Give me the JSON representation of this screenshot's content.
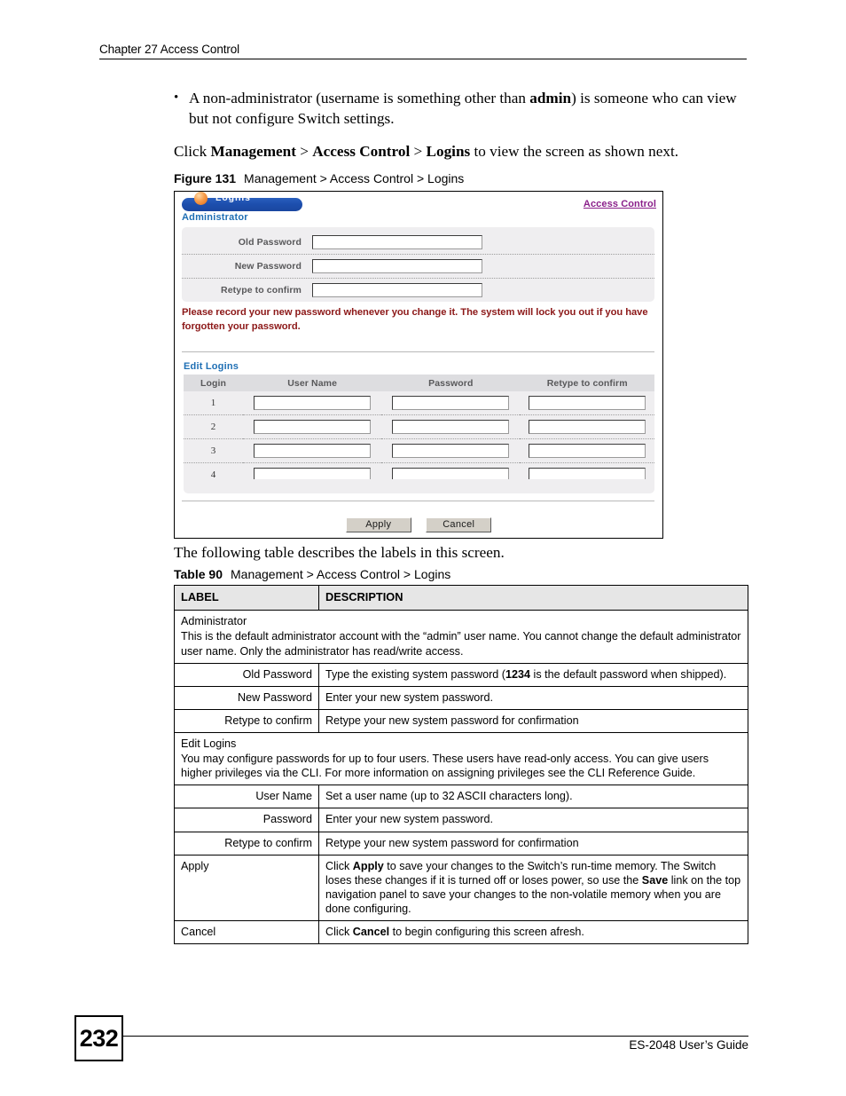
{
  "header": {
    "chapter": "Chapter 27 Access Control"
  },
  "body": {
    "bullet": {
      "marker": "•",
      "part1": " A non-administrator (username is something other than ",
      "bold1": "admin",
      "part2": ") is someone who can view but not configure Switch settings."
    },
    "click_line": {
      "part1": "Click ",
      "bold1": "Management",
      "part2": " > ",
      "bold2": "Access Control",
      "part3": " > ",
      "bold3": "Logins",
      "part4": " to view the screen as shown next."
    },
    "after_figure": "The following table describes the labels in this screen."
  },
  "figure": {
    "caption_number": "Figure 131",
    "caption_text": "Management > Access Control > Logins",
    "title": "Logins",
    "access_control_link": "Access Control",
    "administrator_heading": "Administrator",
    "edit_logins_heading": "Edit Logins",
    "admin_fields": [
      {
        "label": "Old Password",
        "value": ""
      },
      {
        "label": "New Password",
        "value": ""
      },
      {
        "label": "Retype to confirm",
        "value": ""
      }
    ],
    "warning": "Please record your new password whenever you change it. The system will lock you out if you have forgotten your password.",
    "logins_columns": [
      "Login",
      "User Name",
      "Password",
      "Retype to confirm"
    ],
    "logins_rows": [
      {
        "login": "1",
        "user_name": "",
        "password": "",
        "retype": ""
      },
      {
        "login": "2",
        "user_name": "",
        "password": "",
        "retype": ""
      },
      {
        "login": "3",
        "user_name": "",
        "password": "",
        "retype": ""
      },
      {
        "login": "4",
        "user_name": "",
        "password": "",
        "retype": ""
      }
    ],
    "buttons": {
      "apply": "Apply",
      "cancel": "Cancel"
    },
    "colors": {
      "title_bar": "#1d4fae",
      "ball": "#f0842f",
      "link": "#8a1f8a",
      "section_heading": "#1f6fb4",
      "warning": "#8c1818",
      "panel_bg": "#efeef0",
      "table_header_bg": "#dddde0"
    }
  },
  "table": {
    "caption_number": "Table 90",
    "caption_text": "Management > Access Control > Logins",
    "headers": [
      "LABEL",
      "DESCRIPTION"
    ],
    "rows": [
      {
        "type": "group",
        "title": "Administrator",
        "text": "This is the default administrator account with the “admin” user name. You cannot change the default administrator user name. Only the administrator has read/write access."
      },
      {
        "type": "sub",
        "label": "Old Password",
        "desc_part1": "Type the existing system password (",
        "desc_bold": "1234",
        "desc_part2": " is the default password when shipped)."
      },
      {
        "type": "sub",
        "label": "New Password",
        "desc_part1": "Enter your new system password.",
        "desc_bold": "",
        "desc_part2": ""
      },
      {
        "type": "sub",
        "label": "Retype to confirm",
        "desc_part1": "Retype your new system password for confirmation",
        "desc_bold": "",
        "desc_part2": ""
      },
      {
        "type": "group",
        "title": "Edit Logins",
        "text": "You may configure passwords for up to four users. These users have read-only access. You can give users higher privileges via the CLI. For more information on assigning privileges see the CLI Reference Guide."
      },
      {
        "type": "sub",
        "label": "User Name",
        "desc_part1": "Set a user name (up to 32 ASCII characters long).",
        "desc_bold": "",
        "desc_part2": ""
      },
      {
        "type": "sub",
        "label": "Password",
        "desc_part1": "Enter your new system password.",
        "desc_bold": "",
        "desc_part2": ""
      },
      {
        "type": "sub",
        "label": "Retype to confirm",
        "desc_part1": "Retype your new system password for confirmation",
        "desc_bold": "",
        "desc_part2": ""
      },
      {
        "type": "plain",
        "label": "Apply",
        "apply": {
          "p1": "Click ",
          "b1": "Apply",
          "p2": " to save your changes to the Switch’s run-time memory. The Switch loses these changes if it is turned off or loses power, so use the ",
          "b2": "Save",
          "p3": " link on the top navigation panel to save your changes to the non-volatile memory when you are done configuring."
        }
      },
      {
        "type": "plain",
        "label": "Cancel",
        "cancel": {
          "p1": "Click ",
          "b1": "Cancel",
          "p2": " to begin configuring this screen afresh."
        }
      }
    ]
  },
  "footer": {
    "page_number": "232",
    "guide": "ES-2048 User’s Guide"
  }
}
